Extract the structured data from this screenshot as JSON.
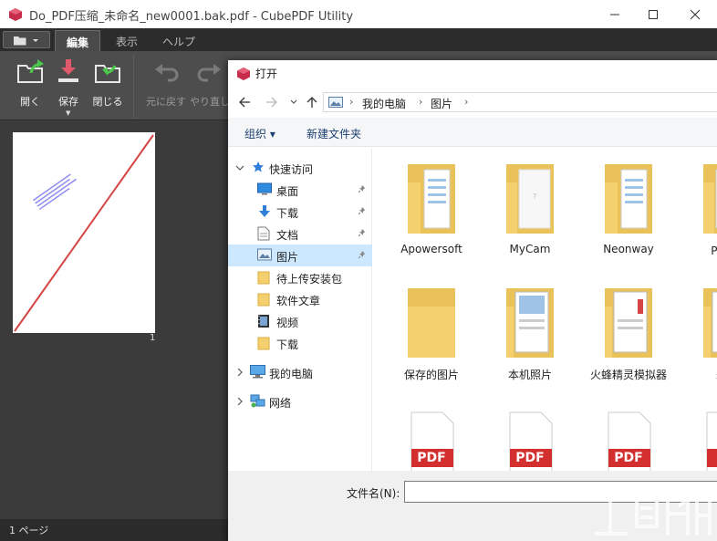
{
  "window": {
    "title": "Do_PDF压缩_未命名_new0001.bak.pdf - CubePDF Utility",
    "controls": [
      "minimize",
      "maximize",
      "close"
    ]
  },
  "tabs": [
    {
      "label": "編集",
      "active": true
    },
    {
      "label": "表示",
      "active": false
    },
    {
      "label": "ヘルプ",
      "active": false
    }
  ],
  "ribbon": {
    "buttons": [
      {
        "label": "開く",
        "icon": "open-icon",
        "enabled": true
      },
      {
        "label": "保存",
        "icon": "save-icon",
        "enabled": true,
        "dropdown": true
      },
      {
        "label": "閉じる",
        "icon": "close-file-icon",
        "enabled": true
      },
      {
        "label": "元に戻す",
        "icon": "undo-icon",
        "enabled": false
      },
      {
        "label": "やり直し",
        "icon": "redo-icon",
        "enabled": false
      }
    ]
  },
  "thumbnail": {
    "page_number": "1"
  },
  "status": {
    "text": "1 ページ"
  },
  "dialog": {
    "title": "打开",
    "breadcrumb": [
      "我的电脑",
      "图片"
    ],
    "commands": {
      "organize": "组织 ▾",
      "new_folder": "新建文件夹"
    },
    "nav": {
      "quick_access": "快速访问",
      "items": [
        "桌面",
        "下载",
        "文档",
        "图片",
        "待上传安装包",
        "软件文章",
        "视频",
        "下载"
      ],
      "this_pc": "我的电脑",
      "network": "网络"
    },
    "files_row1": [
      "Apowersoft",
      "MyCam",
      "Neonway",
      "PDF压"
    ],
    "files_row2": [
      "保存的图片",
      "本机照片",
      "火蜂精灵模拟器",
      "未命"
    ],
    "files_row3_badge": "PDF",
    "filename_label": "文件名(N):",
    "filename_value": ""
  },
  "colors": {
    "dark_bg": "#3b3b3b",
    "ribbon_bg": "#4d4d4d",
    "accent_red": "#d64545",
    "folder_yellow": "#f5d06f",
    "selection_blue": "#cce8ff"
  }
}
